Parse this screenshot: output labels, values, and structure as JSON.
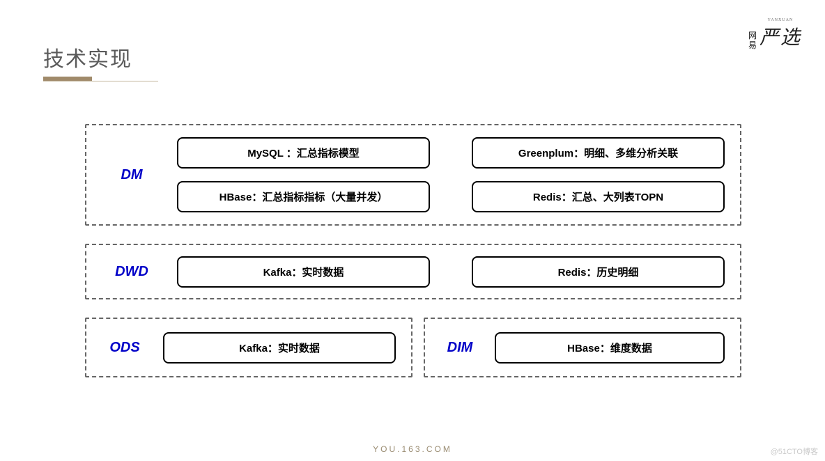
{
  "title": "技术实现",
  "logo": {
    "small_top": "网",
    "small_bottom": "易",
    "big": "严选",
    "tiny": "YANXUAN"
  },
  "layers": {
    "dm": {
      "label": "DM",
      "row1": {
        "left": "MySQL ：汇总指标模型",
        "right": "Greenplum：明细、多维分析关联"
      },
      "row2": {
        "left": "HBase：汇总指标指标（大量并发）",
        "right": "Redis：汇总、大列表TOPN"
      }
    },
    "dwd": {
      "label": "DWD",
      "row": {
        "left": "Kafka：实时数据",
        "right": "Redis：历史明细"
      }
    },
    "ods": {
      "label": "ODS",
      "cell": "Kafka：实时数据"
    },
    "dim": {
      "label": "DIM",
      "cell": "HBase：维度数据"
    }
  },
  "footer": "YOU.163.COM",
  "watermark": "@51CTO博客"
}
